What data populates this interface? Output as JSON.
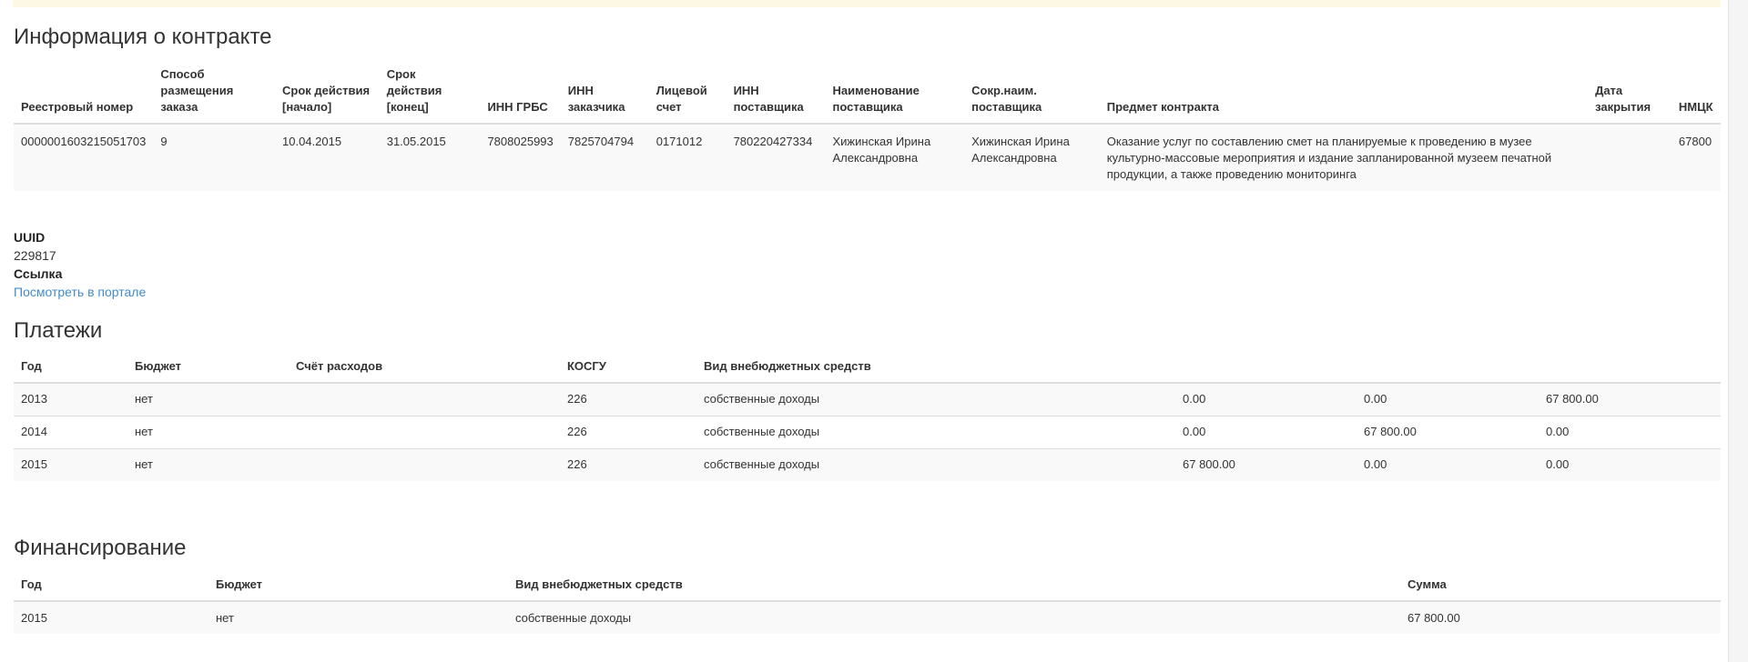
{
  "contract": {
    "title": "Информация о контракте",
    "headers": [
      "Реестровый номер",
      "Способ размещения заказа",
      "Срок действия [начало]",
      "Срок действия [конец]",
      "ИНН ГРБС",
      "ИНН заказчика",
      "Лицевой счет",
      "ИНН поставщика",
      "Наименование поставщика",
      "Сокр.наим. поставщика",
      "Предмет контракта",
      "Дата закрытия",
      "НМЦК"
    ],
    "row": [
      "0000001603215051703",
      "9",
      "10.04.2015",
      "31.05.2015",
      "7808025993",
      "7825704794",
      "0171012",
      "780220427334",
      "Хижинская Ирина Александровна",
      "Хижинская Ирина Александровна",
      "Оказание услуг по составлению смет на планируемые к проведению в музее культурно-массовые мероприятия и издание запланированной музеем печатной продукции, а также проведению мониторинга",
      "",
      "67800"
    ]
  },
  "meta": {
    "uuid_label": "UUID",
    "uuid_value": "229817",
    "link_label": "Ссылка",
    "link_text": "Посмотреть в портале"
  },
  "payments": {
    "title": "Платежи",
    "headers": [
      "Год",
      "Бюджет",
      "Счёт расходов",
      "КОСГУ",
      "Вид внебюджетных средств",
      "",
      "",
      ""
    ],
    "rows": [
      [
        "2013",
        "нет",
        "",
        "226",
        "собственные доходы",
        "0.00",
        "0.00",
        "67 800.00"
      ],
      [
        "2014",
        "нет",
        "",
        "226",
        "собственные доходы",
        "0.00",
        "67 800.00",
        "0.00"
      ],
      [
        "2015",
        "нет",
        "",
        "226",
        "собственные доходы",
        "67 800.00",
        "0.00",
        "0.00"
      ]
    ]
  },
  "financing": {
    "title": "Финансирование",
    "headers": [
      "Год",
      "Бюджет",
      "Вид внебюджетных средств",
      "Сумма"
    ],
    "rows": [
      [
        "2015",
        "нет",
        "собственные доходы",
        "67 800.00"
      ]
    ]
  }
}
